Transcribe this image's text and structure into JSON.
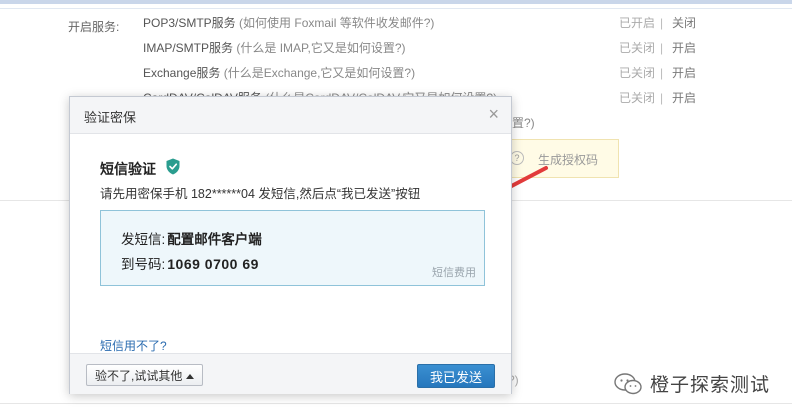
{
  "background": {
    "open_services_label": "开启服务:",
    "services": [
      {
        "name": "POP3/SMTP服务",
        "hint": "(如何使用 Foxmail 等软件收发邮件?)",
        "status": "已开启",
        "action": "关闭"
      },
      {
        "name": "IMAP/SMTP服务",
        "hint": "(什么是 IMAP,它又是如何设置?)",
        "status": "已关闭",
        "action": "开启"
      },
      {
        "name": "Exchange服务",
        "hint": "(什么是Exchange,它又是如何设置?)",
        "status": "已关闭",
        "action": "开启"
      },
      {
        "name": "CardDAV/CalDAV服务",
        "hint": "(什么是CardDAV/CalDAV,它又是如何设置?)",
        "status": "已关闭",
        "action": "开启"
      },
      {
        "name": "",
        "hint": "设置?)",
        "status": "",
        "action": ""
      }
    ],
    "auth_code_tip": "生成授权码",
    "fragment": "?)"
  },
  "dialog": {
    "title": "验证密保",
    "close_symbol": "×",
    "sms_title": "短信验证",
    "instruction": "请先用密保手机 182******04 发短信,然后点“我已发送”按钮",
    "send_label": "发短信:",
    "send_value": "配置邮件客户端",
    "to_label": "到号码:",
    "to_value": "1069 0700 69",
    "fee_label": "短信费用",
    "cant_use": "短信用不了?",
    "other_button": "验不了,试试其他",
    "sent_button": "我已发送"
  },
  "watermark": {
    "text": "橙子探索测试"
  },
  "colors": {
    "primary_button": "#2677bd",
    "info_border": "#8fc3d9",
    "info_bg": "#eef7fb",
    "arrow": "#e23b3b",
    "shield": "#2a9d8f"
  }
}
